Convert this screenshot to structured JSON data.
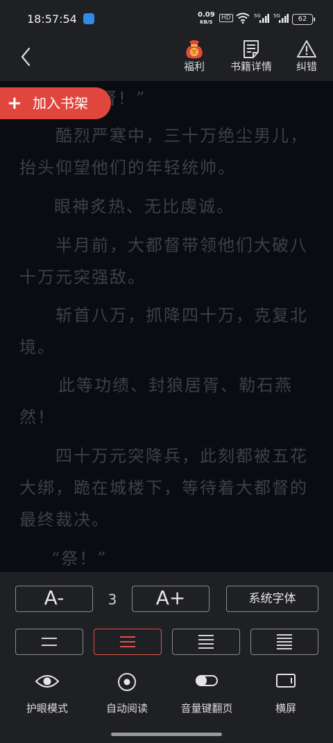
{
  "status_bar": {
    "time": "18:57:54",
    "net_speed_value": "0.09",
    "net_speed_unit": "KB/S",
    "hd_label": "HD",
    "signal1_label": "5G",
    "signal2_label": "5G",
    "battery": "62"
  },
  "header": {
    "actions": [
      {
        "label": "福利",
        "icon": "lucky-bag-icon"
      },
      {
        "label": "书籍详情",
        "icon": "document-icon"
      },
      {
        "label": "纠错",
        "icon": "warning-icon"
      }
    ],
    "lucky_bag_char": "羊"
  },
  "add_shelf": {
    "plus": "+",
    "label": "加入书架"
  },
  "reader": {
    "paragraphs": [
      "大都督！”",
      "酷烈严寒中，三十万绝尘男儿，抬头仰望他们的年轻统帅。",
      "眼神炙热、无比虔诚。",
      "半月前，大都督带领他们大破八十万元突强敌。",
      "斩首八万，抓降四十万，克复北境。",
      "此等功绩、封狼居胥、勒石燕然！",
      "四十万元突降兵，此刻都被五花大绑，跪在城楼下，等待着大都督的最终裁决。",
      "“祭！”"
    ]
  },
  "settings": {
    "font_decrease": "A-",
    "font_size": "3",
    "font_increase": "A+",
    "system_font": "系统字体",
    "spacing_selected_index": 1,
    "features": [
      {
        "label": "护眼模式",
        "icon": "eye-icon"
      },
      {
        "label": "自动阅读",
        "icon": "play-circle-icon"
      },
      {
        "label": "音量键翻页",
        "icon": "toggle-icon"
      },
      {
        "label": "横屏",
        "icon": "landscape-icon"
      }
    ]
  },
  "colors": {
    "accent": "#e0463d",
    "panel": "#1f2024",
    "reader_bg": "#0a0c12"
  }
}
